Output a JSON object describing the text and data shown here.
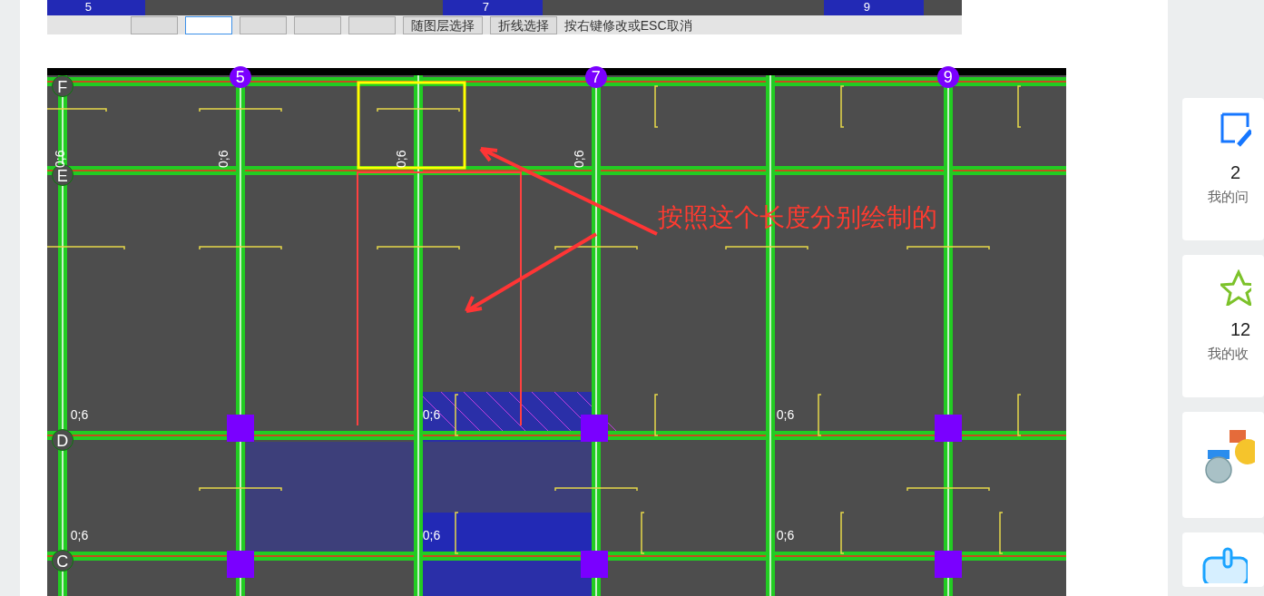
{
  "top_screenshot": {
    "axis_labels": [
      "5",
      "7",
      "9"
    ],
    "toolbar": [
      {
        "kind": "icon",
        "selected": false
      },
      {
        "kind": "icon",
        "selected": true
      },
      {
        "kind": "icon",
        "selected": false
      },
      {
        "kind": "icon",
        "selected": false
      },
      {
        "kind": "icon",
        "selected": false
      },
      {
        "kind": "text",
        "label": "随图层选择",
        "selected": false
      },
      {
        "kind": "text",
        "label": "折线选择",
        "selected": false
      }
    ],
    "hint": "按右键修改或ESC取消"
  },
  "cad": {
    "axis_labels": [
      "F",
      "E",
      "D",
      "C",
      "5",
      "7",
      "9"
    ],
    "dimension_labels": [
      "0;6",
      "0;6",
      "0;6",
      "0;6",
      "0;6",
      "0;6",
      "0;6",
      "0;6",
      "0;6",
      "0;6"
    ],
    "annotation": "按照这个长度分别绘制的"
  },
  "sidebar": {
    "cards": [
      {
        "kind": "note",
        "count": "2",
        "label": "我的问"
      },
      {
        "kind": "star",
        "count": "12",
        "label": "我的收"
      },
      {
        "kind": "medals"
      },
      {
        "kind": "calendar"
      }
    ]
  }
}
